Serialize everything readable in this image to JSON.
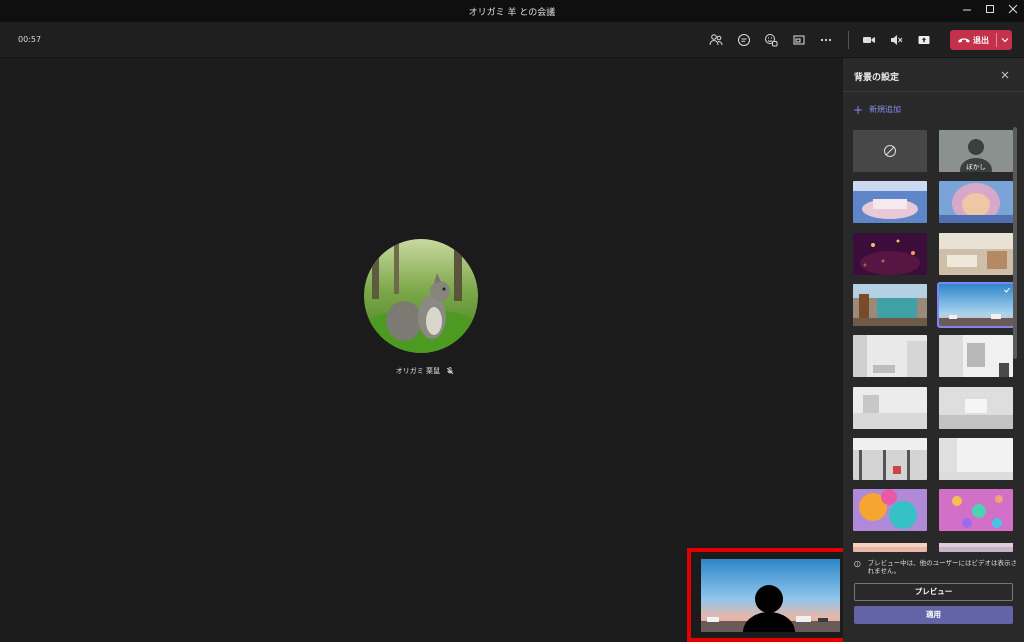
{
  "window": {
    "title": "オリガミ 羊 との会議"
  },
  "toolbar": {
    "timer": "00:57",
    "leave_label": "退出",
    "icons": [
      "participants-icon",
      "chat-icon",
      "reactions-icon",
      "share-tray-icon",
      "more-icon",
      "camera-icon",
      "mute-icon",
      "share-icon"
    ]
  },
  "stage": {
    "caller_name": "オリガミ 栗鼠",
    "caller_muted_icon": "mic-off-icon"
  },
  "panel": {
    "title": "背景の設定",
    "add_new": "新規追加",
    "blur_label": "ぼかし",
    "notice": "プレビュー中は、他のユーザーにはビデオは表示されません。",
    "preview_button": "プレビュー",
    "apply_button": "適用",
    "selected_index": 7
  },
  "colors": {
    "accent": "#6264a7",
    "leave": "#c4314b",
    "highlight": "#e30000"
  }
}
